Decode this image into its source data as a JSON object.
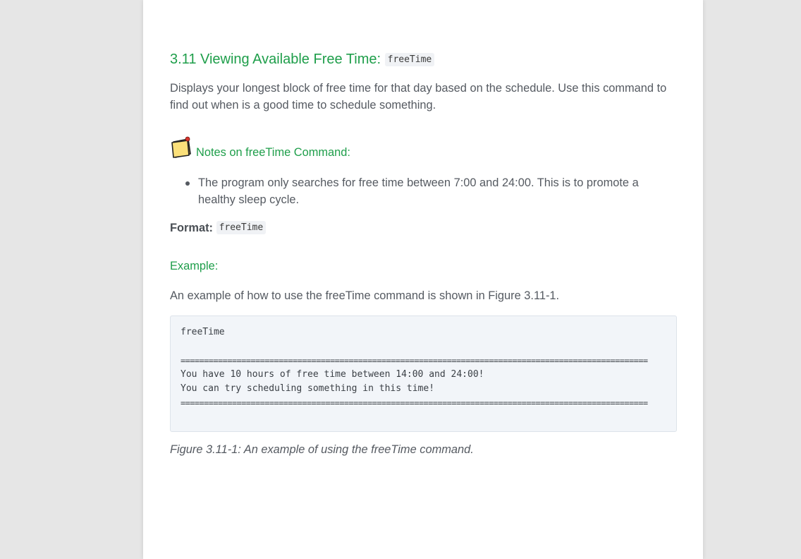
{
  "section": {
    "heading_text": "3.11 Viewing Available Free Time:",
    "heading_code": "freeTime"
  },
  "intro": "Displays your longest block of free time for that day based on the schedule. Use this command to find out when is a good time to schedule something.",
  "note": {
    "icon": "note-icon",
    "title": "Notes on freeTime Command:",
    "items": [
      "The program only searches for free time between 7:00 and 24:00. This is to promote a healthy sleep cycle."
    ]
  },
  "format": {
    "label": "Format:",
    "code": "freeTime"
  },
  "example": {
    "heading": "Example:",
    "description": "An example of how to use the freeTime command is shown in Figure 3.11-1.",
    "code_lines": [
      "freeTime",
      "",
      "====================================================================================================",
      "You have 10 hours of free time between 14:00 and 24:00!",
      "You can try scheduling something in this time!",
      "===================================================================================================="
    ],
    "caption": "Figure 3.11-1: An example of using the freeTime command."
  },
  "colors": {
    "heading_green": "#1e9e4a",
    "body_text": "#555a61",
    "code_bg": "#f2f5f9",
    "page_bg": "#e6e6e6"
  }
}
